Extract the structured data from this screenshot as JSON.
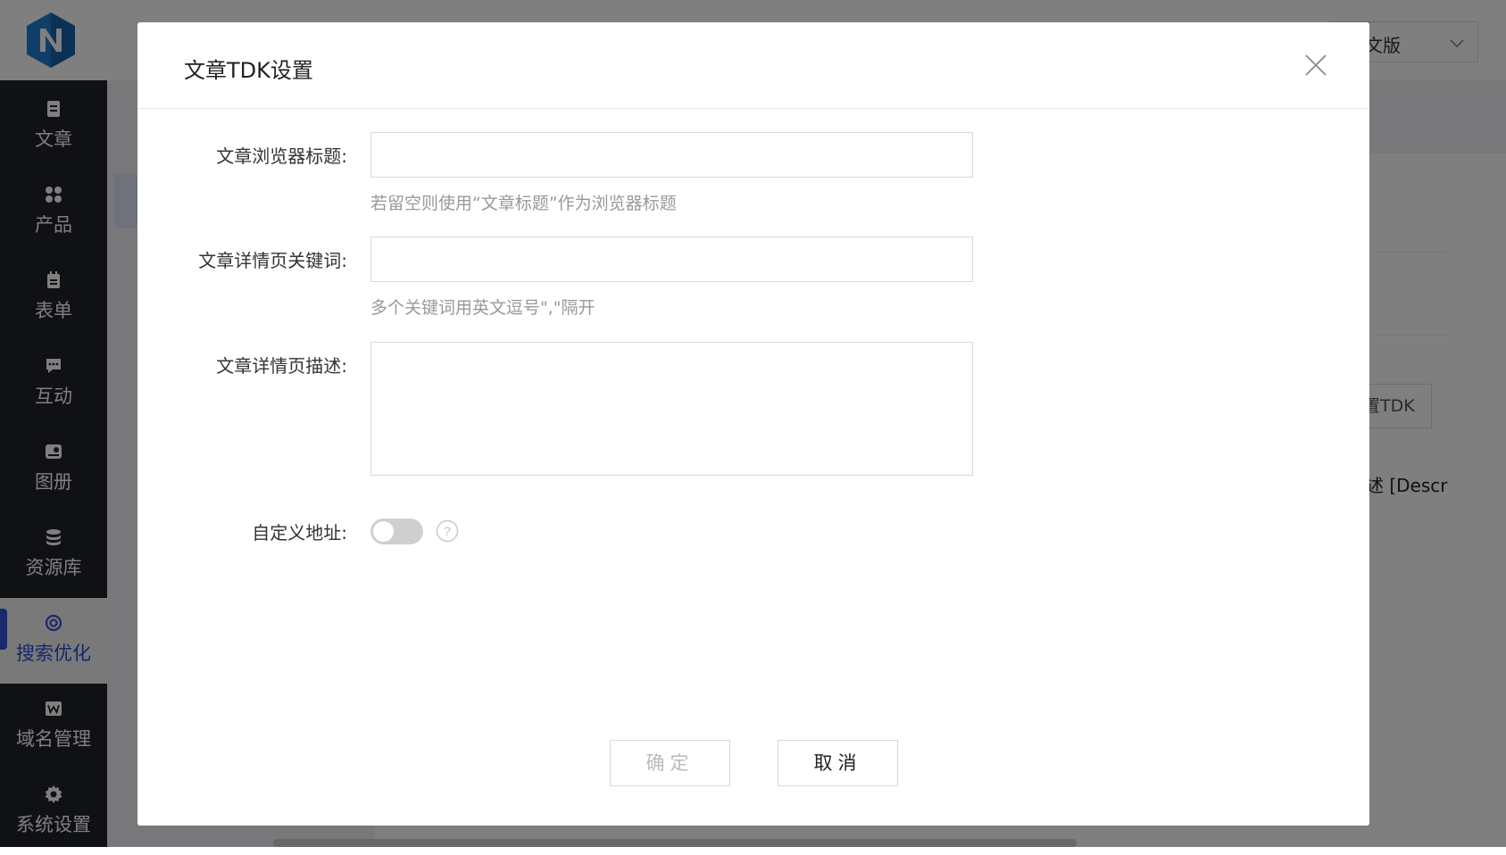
{
  "topbar": {
    "lang_partial": "文版"
  },
  "sidebar": {
    "items": [
      {
        "label": "文章",
        "icon": "article-icon"
      },
      {
        "label": "产品",
        "icon": "product-grid-icon"
      },
      {
        "label": "表单",
        "icon": "form-clipboard-icon"
      },
      {
        "label": "互动",
        "icon": "chat-bubble-icon"
      },
      {
        "label": "图册",
        "icon": "album-image-icon"
      },
      {
        "label": "资源库",
        "icon": "database-icon"
      },
      {
        "label": "搜索优化",
        "icon": "seo-target-icon",
        "active": true
      },
      {
        "label": "域名管理",
        "icon": "domain-w-icon"
      },
      {
        "label": "系统设置",
        "icon": "gear-icon"
      }
    ]
  },
  "background": {
    "tdk_button_partial": "置TDK",
    "desc_partial": "述 [Descr"
  },
  "modal": {
    "title": "文章TDK设置",
    "fields": {
      "browser_title": {
        "label": "文章浏览器标题:",
        "value": "",
        "hint": "若留空则使用“文章标题”作为浏览器标题"
      },
      "keywords": {
        "label": "文章详情页关键词:",
        "value": "",
        "hint": "多个关键词用英文逗号\",\"隔开"
      },
      "description": {
        "label": "文章详情页描述:",
        "value": ""
      },
      "custom_url": {
        "label": "自定义地址:",
        "enabled": false
      }
    },
    "buttons": {
      "confirm": "确定",
      "cancel": "取消"
    }
  },
  "colors": {
    "accent": "#3452d6",
    "sidebar_bg": "#20222a",
    "mask": "rgba(0,0,0,0.5)"
  }
}
